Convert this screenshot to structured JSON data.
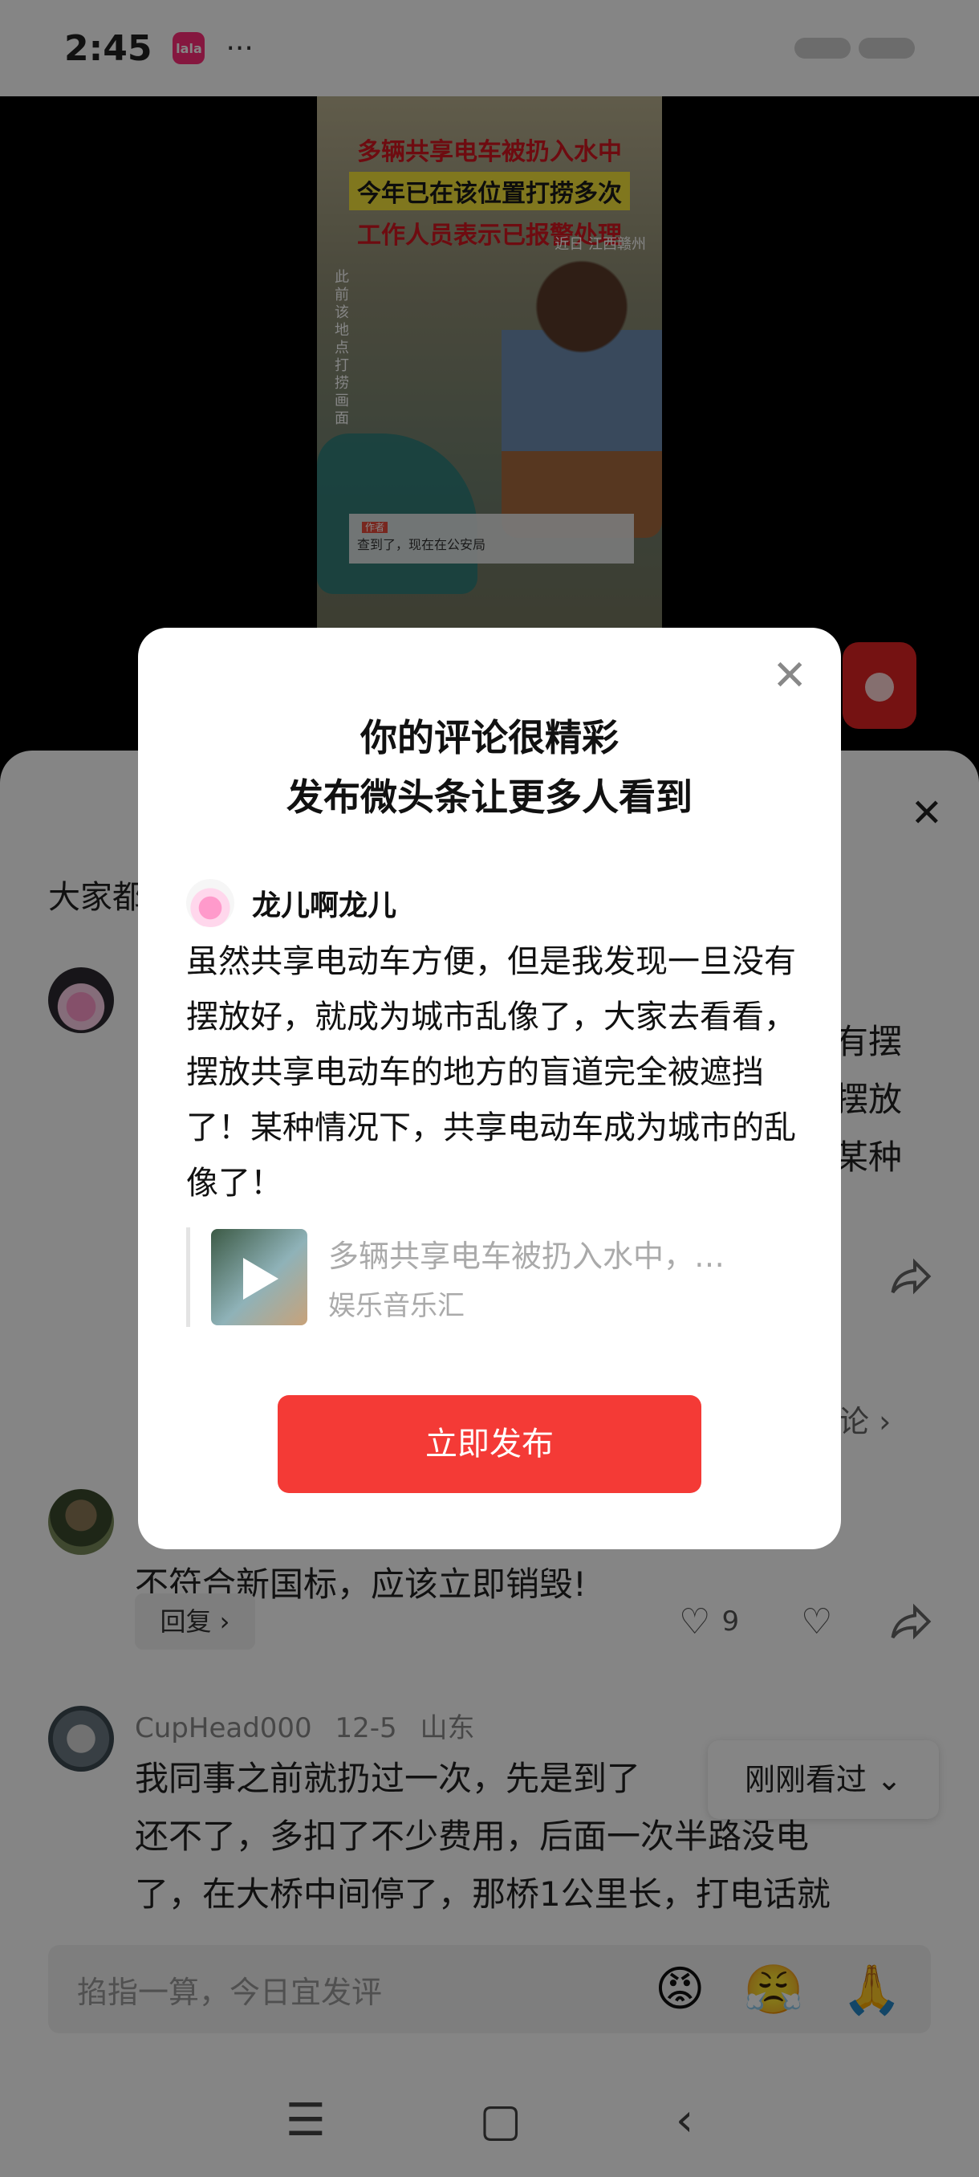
{
  "status_bar": {
    "time": "2:45",
    "app_icon_text": "lala",
    "more": "···"
  },
  "video": {
    "caption_lines": [
      "多辆共享电车被扔入水中",
      "今年已在该位置打捞多次",
      "工作人员表示已报警处理"
    ],
    "location": "近日 江西赣州",
    "vertical_note": "此前该地点打捞画面",
    "comment_overlay": {
      "tag": "作者",
      "text": "查到了，现在在公安局"
    }
  },
  "comments_sheet": {
    "header_partial": "大家都",
    "side_text_lines": [
      "有摆",
      "摆放",
      "某种"
    ],
    "side_link": "论 ›",
    "second_comment_text": "不符合新国标，应该立即销毁!",
    "reply_label": "回复 ›",
    "like_count": "9",
    "third_comment": {
      "username": "CupHead000",
      "date": "12-5",
      "location": "山东",
      "lines": [
        "我同事之前就扔过一次，先是到了",
        "还不了，多扣了不少费用，后面一次半路没电",
        "了，在大桥中间停了，那桥1公里长，打电话就"
      ]
    },
    "seen_pill": "刚刚看过 ⌄",
    "input_placeholder": "掐指一算，今日宜发评",
    "emojis": [
      "😡",
      "😤",
      "🙏"
    ],
    "nav": [
      "☰",
      "▢",
      "‹"
    ]
  },
  "modal": {
    "title_line1": "你的评论很精彩",
    "title_line2": "发布微头条让更多人看到",
    "username": "龙儿啊龙儿",
    "body": "虽然共享电动车方便，但是我发现一旦没有摆放好，就成为城市乱像了，大家去看看，摆放共享电动车的地方的盲道完全被遮挡了！某种情况下，共享电动车成为城市的乱像了！",
    "quote_title": "多辆共享电车被扔入水中，…",
    "quote_source": "娱乐音乐汇",
    "publish_label": "立即发布"
  }
}
